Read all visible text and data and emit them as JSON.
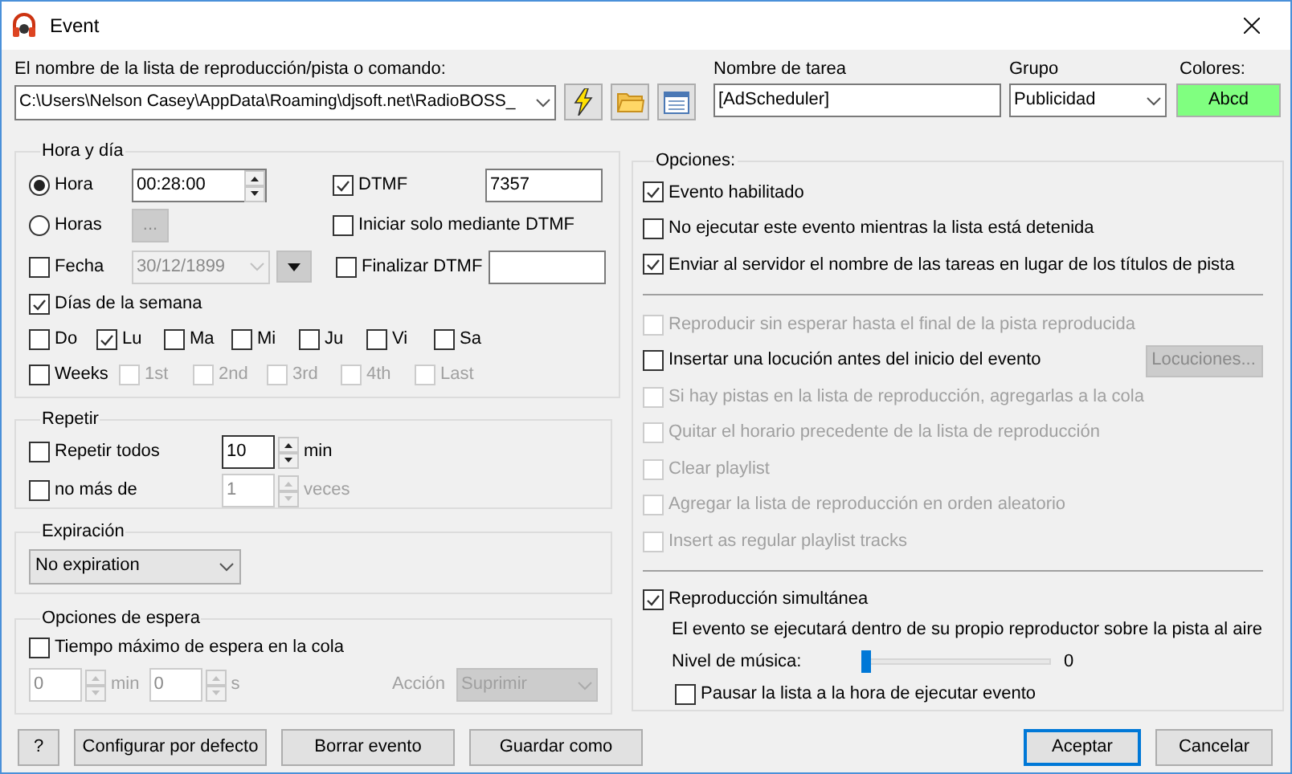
{
  "window": {
    "title": "Event"
  },
  "command": {
    "label": "El nombre de la lista de reproducción/pista o comando:",
    "value": "C:\\Users\\Nelson Casey\\AppData\\Roaming\\djsoft.net\\RadioBOSS_"
  },
  "task_name": {
    "label": "Nombre de tarea",
    "value": "[AdScheduler]"
  },
  "group": {
    "label": "Grupo",
    "value": "Publicidad"
  },
  "colors": {
    "label": "Colores:",
    "sample": "Abcd",
    "color": "#80ff80"
  },
  "time_day": {
    "title": "Hora y día",
    "hora": {
      "label": "Hora",
      "selected": true,
      "value": "00:28:00"
    },
    "horas": {
      "label": "Horas",
      "selected": false,
      "button": "..."
    },
    "fecha": {
      "label": "Fecha",
      "checked": false,
      "value": "30/12/1899"
    },
    "dtmf": {
      "label": "DTMF",
      "checked": true,
      "value": "7357"
    },
    "start_dtmf": {
      "label": "Iniciar solo mediante DTMF",
      "checked": false
    },
    "end_dtmf": {
      "label": "Finalizar DTMF",
      "checked": false
    },
    "weekdays": {
      "label": "Días de la semana",
      "checked": true
    },
    "days": [
      {
        "label": "Do",
        "checked": false
      },
      {
        "label": "Lu",
        "checked": true
      },
      {
        "label": "Ma",
        "checked": false
      },
      {
        "label": "Mi",
        "checked": false
      },
      {
        "label": "Ju",
        "checked": false
      },
      {
        "label": "Vi",
        "checked": false
      },
      {
        "label": "Sa",
        "checked": false
      }
    ],
    "weeks": {
      "label": "Weeks",
      "checked": false
    },
    "week_items": [
      {
        "label": "1st",
        "checked": false,
        "disabled": true
      },
      {
        "label": "2nd",
        "checked": false,
        "disabled": true
      },
      {
        "label": "3rd",
        "checked": false,
        "disabled": true
      },
      {
        "label": "4th",
        "checked": false,
        "disabled": true
      },
      {
        "label": "Last",
        "checked": false,
        "disabled": true
      }
    ]
  },
  "repeat": {
    "title": "Repetir",
    "every": {
      "label": "Repetir todos",
      "checked": false,
      "value": "10",
      "unit": "min"
    },
    "max": {
      "label": "no más de",
      "checked": false,
      "value": "1",
      "unit": "veces",
      "disabled": true
    }
  },
  "expiration": {
    "title": "Expiración",
    "value": "No expiration"
  },
  "wait": {
    "title": "Opciones de espera",
    "label": "Tiempo máximo de espera en la cola",
    "checked": false,
    "minutes": {
      "value": "0",
      "unit": "min"
    },
    "seconds": {
      "value": "0",
      "unit": "s"
    },
    "action": {
      "label": "Acción",
      "value": "Suprimir"
    },
    "disabled": true
  },
  "options": {
    "title": "Opciones:",
    "items": [
      {
        "kind": "check",
        "label": "Evento habilitado",
        "checked": true,
        "disabled": false
      },
      {
        "kind": "check",
        "label": "No ejecutar este evento mientras la lista está detenida",
        "checked": false,
        "disabled": false
      },
      {
        "kind": "check",
        "label": "Enviar al servidor el nombre de las tareas en lugar de los títulos de pista",
        "checked": true,
        "disabled": false
      },
      {
        "kind": "divider"
      },
      {
        "kind": "check",
        "label": "Reproducir sin esperar hasta el final de la pista reproducida",
        "checked": false,
        "disabled": true
      },
      {
        "kind": "check",
        "label": "Insertar una locución antes del inicio del evento",
        "checked": false,
        "disabled": false,
        "button": "Locuciones..."
      },
      {
        "kind": "check",
        "label": "Si hay pistas en la lista de reproducción, agregarlas a la cola",
        "checked": false,
        "disabled": true
      },
      {
        "kind": "check",
        "label": "Quitar el horario precedente de la lista de reproducción",
        "checked": false,
        "disabled": true
      },
      {
        "kind": "check",
        "label": "Clear playlist",
        "checked": false,
        "disabled": true
      },
      {
        "kind": "check",
        "label": "Agregar la lista de reproducción en orden aleatorio",
        "checked": false,
        "disabled": true
      },
      {
        "kind": "check",
        "label": "Insert as regular playlist tracks",
        "checked": false,
        "disabled": true
      },
      {
        "kind": "divider"
      }
    ],
    "simultaneous": {
      "label": "Reproducción simultánea",
      "checked": true,
      "note": "El evento se ejecutará dentro de su propio reproductor sobre la pista al aire",
      "music_level": {
        "label": "Nivel de música:",
        "level": 0,
        "reading": "0"
      },
      "pause": {
        "label": "Pausar la lista a la hora de ejecutar evento",
        "checked": false
      }
    }
  },
  "footer_left": [
    {
      "label": "?"
    },
    {
      "label": "Configurar por defecto"
    },
    {
      "label": "Borrar evento"
    },
    {
      "label": "Guardar como"
    }
  ],
  "footer_right": [
    {
      "label": "Aceptar",
      "default": true
    },
    {
      "label": "Cancelar",
      "default": false
    }
  ]
}
